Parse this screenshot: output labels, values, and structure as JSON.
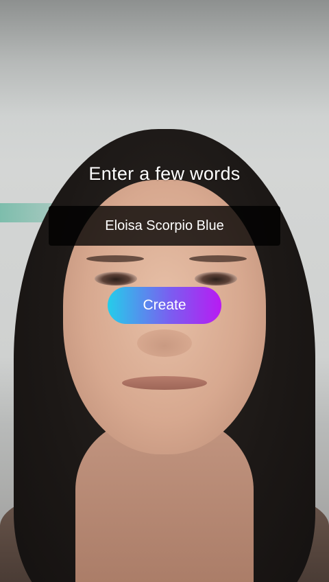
{
  "prompt": {
    "title": "Enter a few words"
  },
  "input": {
    "value": "Eloisa Scorpio Blue"
  },
  "actions": {
    "create_label": "Create"
  },
  "colors": {
    "button_gradient_start": "#25cdea",
    "button_gradient_end": "#b81bf2",
    "field_background": "#000000"
  }
}
